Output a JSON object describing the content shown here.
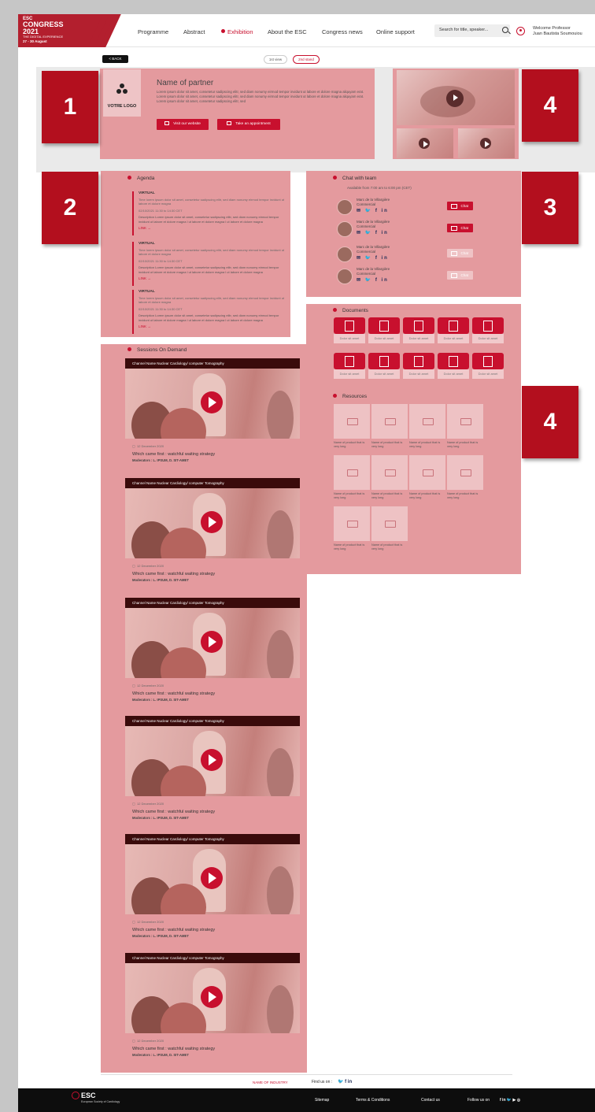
{
  "brand": {
    "line1": "ESC",
    "line2": "CONGRESS",
    "line3": "2021",
    "line4": "THE DIGITAL EXPERIENCE",
    "line5": "27 - 30 August"
  },
  "nav": {
    "items": [
      "Programme",
      "Abstract",
      "Exhibition",
      "About the ESC",
      "Congress news",
      "Online support"
    ],
    "active": "Exhibition"
  },
  "search": {
    "placeholder": "Search for title, speaker..."
  },
  "user": {
    "welcome": "Welcome Professor",
    "name": "Juan Bautista Soumouiou"
  },
  "subbar": {
    "back": "< BACK",
    "view1": "1st view",
    "view2": "2nd stand"
  },
  "badges": [
    "1",
    "2",
    "3",
    "4",
    "4"
  ],
  "partner": {
    "logo_text": "VOTRE LOGO",
    "name": "Name of partner",
    "description": "Lorem ipsum dolor sit amet, consetetur sadipscing elitr, sed diam nonumy eirmod tempor invidunt ut labore et dolore magna aliquyam erat. Lorem ipsum dolor sit amet, consetetur sadipscing elitr, sed diam nonumy eirmod tempor invidunt ut labore et dolore magna aliquyam erat. Lorem ipsum dolor sit amet, consetetur sadipscing elitr, sed",
    "btn_website": "Visit our website",
    "btn_appointment": "Take an appointment"
  },
  "agenda": {
    "title": "Agenda",
    "items": [
      {
        "tag": "VIRTUAL",
        "title": "Time lorem ipsum dolor sit amet, consetetur sadipscing elitr, sed diam nonumy eirmod tempor invidunt ut labore et dolore magna",
        "time": "02/10/2021  11:30 to 14:30 CET",
        "desc": "Description Lorem ipsum dolor sit amet, consetetur sadipscing elitr, sed diam nonumy eirmod tempor invidunt ut labore et dolore magna l ut labore et dolore magna l ut labore et dolore magna",
        "link": "LINK"
      },
      {
        "tag": "VIRTUAL",
        "title": "Time lorem ipsum dolor sit amet, consetetur sadipscing elitr, sed diam nonumy eirmod tempor invidunt ut labore et dolore magna",
        "time": "02/10/2021  11:30 to 14:30 CET",
        "desc": "Description Lorem ipsum dolor sit amet, consetetur sadipscing elitr, sed diam nonumy eirmod tempor invidunt ut labore et dolore magna l ut labore et dolore magna l ut labore et dolore magna",
        "link": "LINK"
      },
      {
        "tag": "VIRTUAL",
        "title": "Time lorem ipsum dolor sit amet, consetetur sadipscing elitr, sed diam nonumy eirmod tempor invidunt ut labore et dolore magna",
        "time": "02/10/2021  11:30 to 14:30 CET",
        "desc": "Description Lorem ipsum dolor sit amet, consetetur sadipscing elitr, sed diam nonumy eirmod tempor invidunt ut labore et dolore magna l ut labore et dolore magna l ut labore et dolore magna",
        "link": "LINK"
      }
    ]
  },
  "chat": {
    "title": "Chat with team",
    "availability": "Available from 7:00 am to 6:00 pm (CET)",
    "members": [
      {
        "name": "Marc de la Villargière",
        "role": "Commercial",
        "socials": "✉ 🐦 f in",
        "button": "Chat"
      },
      {
        "name": "Marc de la Villargière",
        "role": "Commercial",
        "socials": "✉ 🐦 f in",
        "button": "Chat"
      },
      {
        "name": "Marc de la Villargière",
        "role": "Commercial",
        "socials": "✉ 🐦 f in",
        "button": "Chat"
      },
      {
        "name": "Marc de la Villargière",
        "role": "Commercial",
        "socials": "✉ 🐦 f in",
        "button": "Chat"
      }
    ]
  },
  "documents": {
    "title": "Documents",
    "label": "Dolor sit amet"
  },
  "resources": {
    "title": "Resources",
    "label": "Name of product that is very long"
  },
  "sessions": {
    "title": "Sessions On Demand",
    "channel": "Channel Name Nuclear Cardiology/ computer Tomography",
    "date": "12 December 2020",
    "session_title": "Which came first : watchful waiting strategy",
    "moderators": "Moderators : L. IPSUM, D. SIT-AMET"
  },
  "footer": {
    "industry": "NAME OF INDUSTRY",
    "find_us": "Find us on :",
    "find_icons": "🐦  f  in",
    "logo_big": "ESC",
    "logo_small": "European Society of Cardiology",
    "sitemap": "Sitemap",
    "terms": "Terms & Conditions",
    "contact": "Contact us",
    "follow": "Follow us on",
    "follow_icons": "f in 🐦 ▶ ◎"
  },
  "colors": {
    "brand_red": "#c8102e",
    "overlay": "#e49a9e",
    "badge": "#b30f1e",
    "footer": "#0d0d0d"
  }
}
